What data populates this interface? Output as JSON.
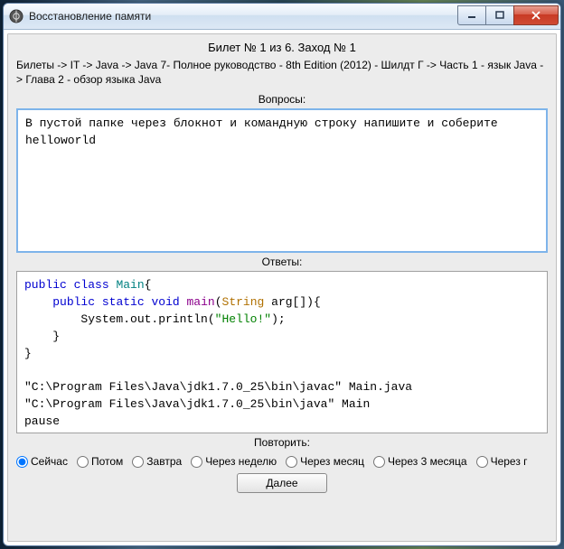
{
  "window": {
    "title": "Восстановление памяти"
  },
  "header": "Билет № 1 из 6. Заход № 1",
  "breadcrumb": "Билеты -> IT -> Java -> Java 7- Полное руководство - 8th Edition (2012) - Шилдт Г -> Часть 1 - язык Java -> Глава 2 - обзор языка Java",
  "labels": {
    "questions": "Вопросы:",
    "answers": "Ответы:",
    "repeat": "Повторить:"
  },
  "question": "В пустой папке через блокнот и командную строку напишите и соберите helloworld",
  "answer_plain": "public class Main{\n    public static void main(String arg[]){\n        System.out.println(\"Hello!\");\n    }\n}\n\n\"C:\\Program Files\\Java\\jdk1.7.0_25\\bin\\javac\" Main.java\n\"C:\\Program Files\\Java\\jdk1.7.0_25\\bin\\java\" Main\npause",
  "repeat_options": [
    {
      "label": "Сейчас",
      "checked": true
    },
    {
      "label": "Потом",
      "checked": false
    },
    {
      "label": "Завтра",
      "checked": false
    },
    {
      "label": "Через неделю",
      "checked": false
    },
    {
      "label": "Через месяц",
      "checked": false
    },
    {
      "label": "Через 3 месяца",
      "checked": false
    },
    {
      "label": "Через г",
      "checked": false
    }
  ],
  "next_button": "Далее"
}
